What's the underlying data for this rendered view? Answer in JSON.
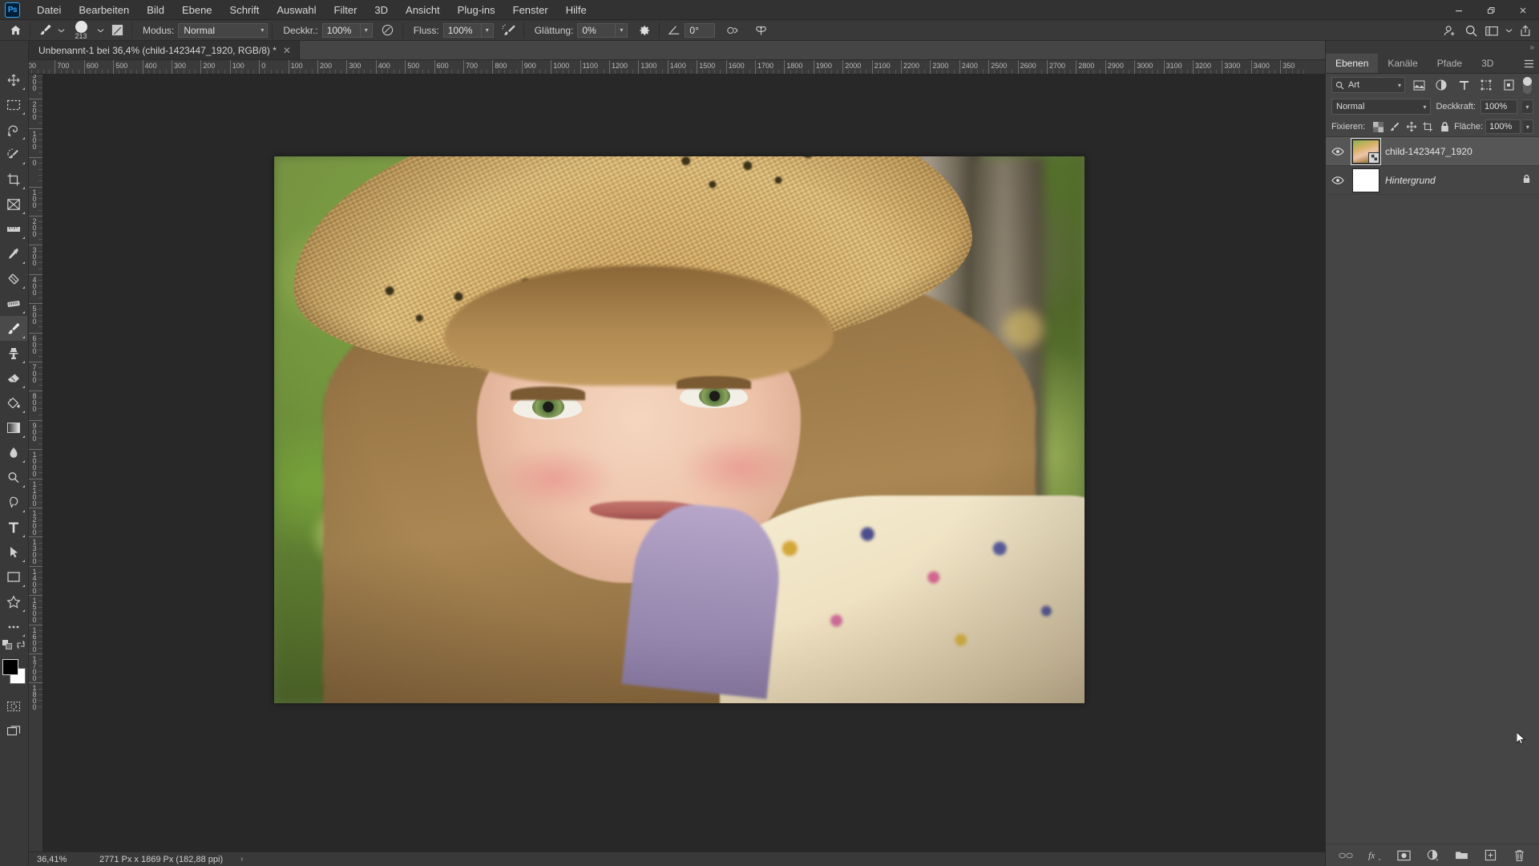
{
  "app": {
    "name": "Photoshop",
    "logo_text": "Ps"
  },
  "menubar": {
    "items": [
      {
        "label": "Datei"
      },
      {
        "label": "Bearbeiten"
      },
      {
        "label": "Bild"
      },
      {
        "label": "Ebene"
      },
      {
        "label": "Schrift"
      },
      {
        "label": "Auswahl"
      },
      {
        "label": "Filter"
      },
      {
        "label": "3D"
      },
      {
        "label": "Ansicht"
      },
      {
        "label": "Plug-ins"
      },
      {
        "label": "Fenster"
      },
      {
        "label": "Hilfe"
      }
    ],
    "window_controls": {
      "minimize": "–",
      "maximize": "❐",
      "close": "✕"
    }
  },
  "options_bar": {
    "home_icon": "home-icon",
    "tool_icon": "brush-tool-icon",
    "brush_size": "213",
    "brush_settings_icon": "brush-settings-icon",
    "mode_label": "Modus:",
    "mode_value": "Normal",
    "opacity_label": "Deckkr.:",
    "opacity_value": "100%",
    "pressure_opacity_icon": "pressure-opacity-icon",
    "flow_label": "Fluss:",
    "flow_value": "100%",
    "airbrush_icon": "airbrush-icon",
    "smoothing_label": "Glättung:",
    "smoothing_value": "0%",
    "smoothing_settings_icon": "gear-icon",
    "angle_icon": "brush-angle-icon",
    "angle_value": "0°",
    "pressure_size_icon": "pressure-size-icon",
    "symmetry_icon": "symmetry-butterfly-icon",
    "right_icons": [
      "add-person-icon",
      "search-icon",
      "workspace-icon",
      "chevron-down-icon",
      "share-icon"
    ]
  },
  "tab_bar": {
    "collapse_icon": "chevron-double-right-icon",
    "document_title": "Unbenannt-1 bei 36,4% (child-1423447_1920, RGB/8) *",
    "close_icon": "✕"
  },
  "toolbar": {
    "tools": [
      {
        "name": "move-tool",
        "glyph": "move"
      },
      {
        "name": "rectangular-marquee-tool",
        "glyph": "marquee"
      },
      {
        "name": "lasso-tool",
        "glyph": "lasso"
      },
      {
        "name": "quick-selection-tool",
        "glyph": "quickselect"
      },
      {
        "name": "crop-tool",
        "glyph": "crop"
      },
      {
        "name": "frame-tool",
        "glyph": "frame"
      },
      {
        "name": "ruler-tool",
        "glyph": "ruler"
      },
      {
        "name": "eyedropper-tool",
        "glyph": "eyedropper"
      },
      {
        "name": "healing-brush-tool",
        "glyph": "healing"
      },
      {
        "name": "eraser-strip-tool",
        "glyph": "patch"
      },
      {
        "name": "brush-tool",
        "glyph": "brush",
        "active": true
      },
      {
        "name": "clone-stamp-tool",
        "glyph": "stamp"
      },
      {
        "name": "eraser-tool",
        "glyph": "eraser"
      },
      {
        "name": "paint-bucket-tool",
        "glyph": "bucket"
      },
      {
        "name": "gradient-tool",
        "glyph": "gradient"
      },
      {
        "name": "blur-tool",
        "glyph": "blur"
      },
      {
        "name": "dodge-tool",
        "glyph": "dodge"
      },
      {
        "name": "pen-tool",
        "glyph": "pen"
      },
      {
        "name": "type-tool",
        "glyph": "type"
      },
      {
        "name": "path-selection-tool",
        "glyph": "arrow"
      },
      {
        "name": "rectangle-tool",
        "glyph": "rect"
      },
      {
        "name": "custom-shape-tool",
        "glyph": "shape"
      },
      {
        "name": "more-tools",
        "glyph": "dots"
      }
    ],
    "quick_mask_icon": "quick-mask-icon",
    "screen_mode_icon": "screen-mode-icon",
    "swap_colors_icon": "swap-colors-icon",
    "default_colors_icon": "default-colors-icon",
    "foreground_color": "#000000",
    "background_color": "#ffffff"
  },
  "rulers": {
    "horizontal": [
      "00",
      "700",
      "600",
      "500",
      "400",
      "300",
      "200",
      "100",
      "0",
      "100",
      "200",
      "300",
      "400",
      "500",
      "600",
      "700",
      "800",
      "900",
      "1000",
      "1100",
      "1200",
      "1300",
      "1400",
      "1500",
      "1600",
      "1700",
      "1800",
      "1900",
      "2000",
      "2100",
      "2200",
      "2300",
      "2400",
      "2500",
      "2600",
      "2700",
      "2800",
      "2900",
      "3000",
      "3100",
      "3200",
      "3300",
      "3400",
      "350"
    ],
    "vertical": [
      "3 0 0",
      "2 0 0",
      "1 0 0",
      "0",
      "1 0 0",
      "2 0 0",
      "3 0 0",
      "4 0 0",
      "5 0 0",
      "6 0 0",
      "7 0 0",
      "8 0 0",
      "9 0 0",
      "1 0 0 0",
      "1 1 0 0",
      "1 2 0 0",
      "1 3 0 0",
      "1 4 0 0",
      "1 5 0 0",
      "1 6 0 0",
      "1 7 0 0",
      "1 8 0 0"
    ],
    "unit": "Px"
  },
  "panel": {
    "collapse_icon": "chevron-double-right-icon",
    "tabs": [
      {
        "label": "Ebenen",
        "active": true
      },
      {
        "label": "Kanäle",
        "active": false
      },
      {
        "label": "Pfade",
        "active": false
      },
      {
        "label": "3D",
        "active": false
      }
    ],
    "menu_icon": "panel-menu-icon",
    "filter": {
      "search_icon": "search-icon",
      "value": "Art",
      "chevron": "∨",
      "type_icons": [
        "pixel-filter-icon",
        "adjustment-filter-icon",
        "type-filter-icon",
        "shape-filter-icon",
        "smart-object-filter-icon"
      ],
      "toggle_name": "filter-toggle"
    },
    "blend": {
      "mode_value": "Normal",
      "chevron": "∨",
      "opacity_label": "Deckkraft:",
      "opacity_value": "100%"
    },
    "lock": {
      "label": "Fixieren:",
      "icons": [
        "lock-transparent-pixels-icon",
        "lock-image-pixels-icon",
        "lock-position-icon",
        "lock-artboard-nesting-icon",
        "lock-all-icon"
      ],
      "fill_label": "Fläche:",
      "fill_value": "100%"
    },
    "layers": [
      {
        "name": "child-1423447_1920",
        "visible": true,
        "selected": true,
        "italic": false,
        "locked": false,
        "smart_object": true,
        "thumb_type": "photo"
      },
      {
        "name": "Hintergrund",
        "visible": true,
        "selected": false,
        "italic": true,
        "locked": true,
        "smart_object": false,
        "thumb_type": "white"
      }
    ],
    "footer_icons": [
      "link-layers-icon",
      "layer-style-fx-icon",
      "add-layer-mask-icon",
      "new-adjustment-layer-icon",
      "new-group-icon",
      "new-layer-icon",
      "delete-layer-icon"
    ]
  },
  "status_bar": {
    "zoom": "36,41%",
    "dimensions": "2771 Px x 1869 Px (182,88 ppi)",
    "arrow": "›"
  },
  "canvas": {
    "document_background": "#282828",
    "image_alt": "portrait of a girl wearing a straw sun hat"
  },
  "colors": {
    "app_bg": "#323232",
    "panel_bg": "#454545",
    "toolbar_bg": "#393939",
    "canvas_bg": "#282828",
    "accent": "#31a8ff",
    "text": "#d2d2d2"
  }
}
